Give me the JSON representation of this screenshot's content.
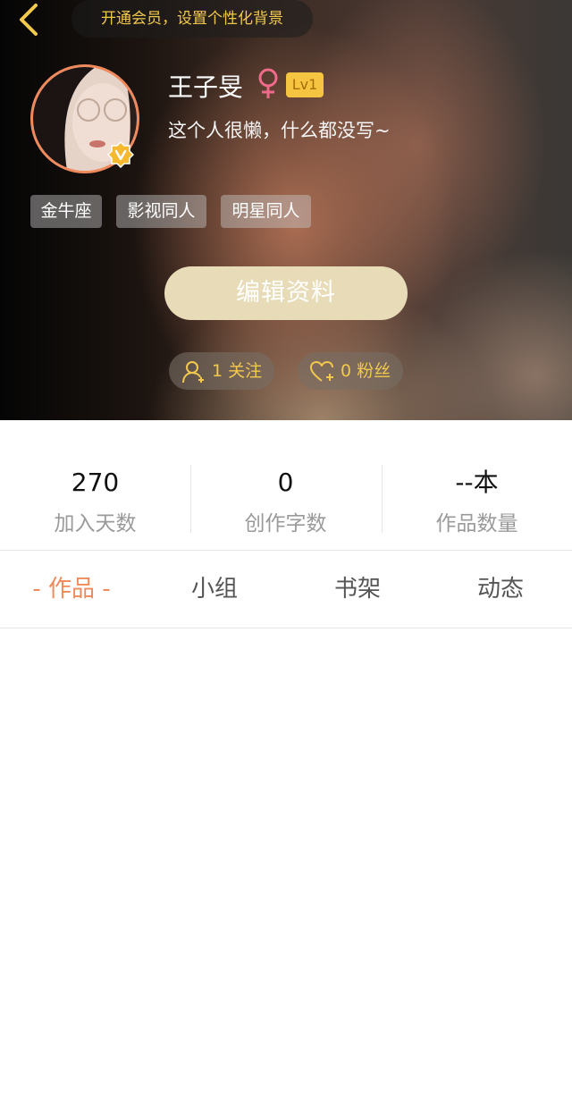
{
  "header": {
    "vip_banner": "开通会员，设置个性化背景"
  },
  "profile": {
    "username": "王子旻",
    "gender": "female",
    "level": "Lv1",
    "bio": "这个人很懒，什么都没写~",
    "tags": [
      "金牛座",
      "影视同人",
      "明星同人"
    ],
    "edit_button": "编辑资料",
    "following": "1 关注",
    "fans": "0 粉丝"
  },
  "stats": [
    {
      "value": "270",
      "label": "加入天数"
    },
    {
      "value": "0",
      "label": "创作字数"
    },
    {
      "value": "--本",
      "label": "作品数量"
    }
  ],
  "tabs": [
    "- 作品 -",
    "小组",
    "书架",
    "动态"
  ],
  "colors": {
    "accent": "#ef8a5a",
    "gold": "#f2c94c",
    "edit_button_bg": "#e8dcb8"
  }
}
